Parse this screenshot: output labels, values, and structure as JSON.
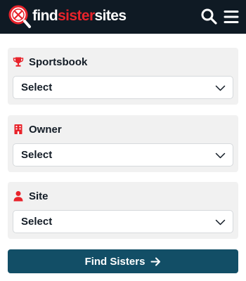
{
  "header": {
    "brand_part1": "find",
    "brand_part2": "sister",
    "brand_part3": "sites",
    "colors": {
      "background": "#0f1a24",
      "accent": "#e8232b",
      "text": "#ffffff"
    },
    "icons": [
      "logo-magnifier-icon",
      "search-icon",
      "hamburger-menu-icon"
    ]
  },
  "filters": [
    {
      "label": "Sportsbook",
      "icon": "trophy-icon",
      "value": "Select"
    },
    {
      "label": "Owner",
      "icon": "building-icon",
      "value": "Select"
    },
    {
      "label": "Site",
      "icon": "user-icon",
      "value": "Select"
    }
  ],
  "cta": {
    "label": "Find Sisters",
    "icon": "arrow-right-icon",
    "color": "#124e66"
  }
}
